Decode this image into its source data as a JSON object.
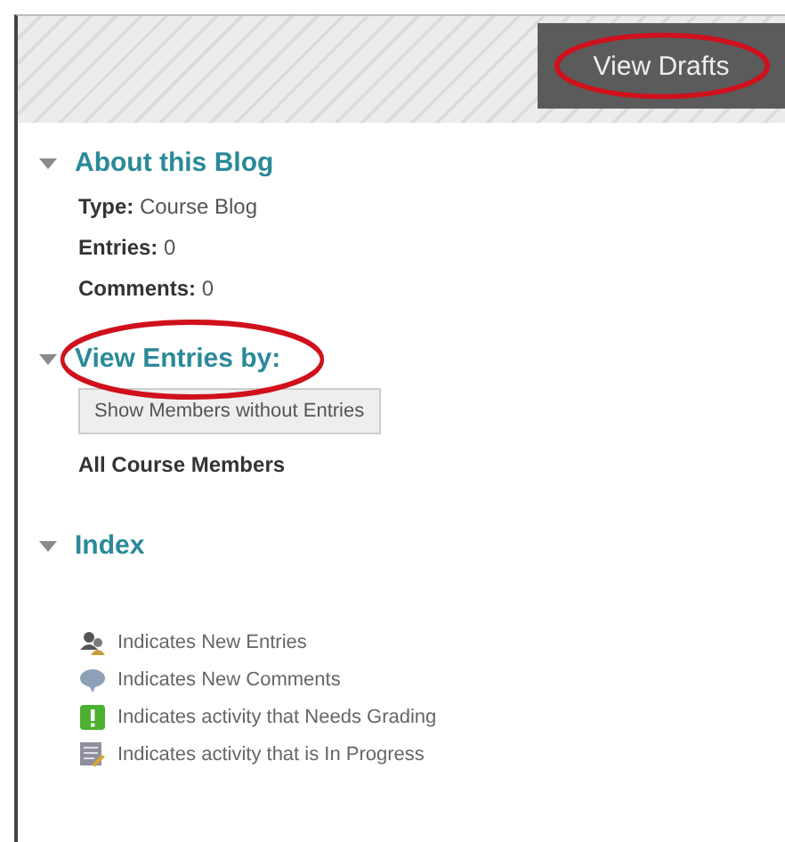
{
  "toolbar": {
    "button": {
      "label": "View Drafts",
      "circled": true
    }
  },
  "about": {
    "title": "About this Blog",
    "expanded": true,
    "fields": [
      {
        "label": "Type:",
        "value": "Course Blog"
      },
      {
        "label": "Entries:",
        "value": "0"
      },
      {
        "label": "Comments:",
        "value": "0"
      }
    ]
  },
  "view_entries": {
    "title": "View Entries by:",
    "circled": true,
    "button": "Show Members without Entries",
    "selection": "All Course Members"
  },
  "index": {
    "title": "Index",
    "expanded": true,
    "items": [
      {
        "kind": "entries",
        "label": "Indicates New Entries"
      },
      {
        "kind": "comments",
        "label": "Indicates New Comments"
      },
      {
        "kind": "grading",
        "label": "Indicates activity that Needs Grading"
      },
      {
        "kind": "progress",
        "label": "Indicates activity that is In Progress"
      }
    ]
  }
}
